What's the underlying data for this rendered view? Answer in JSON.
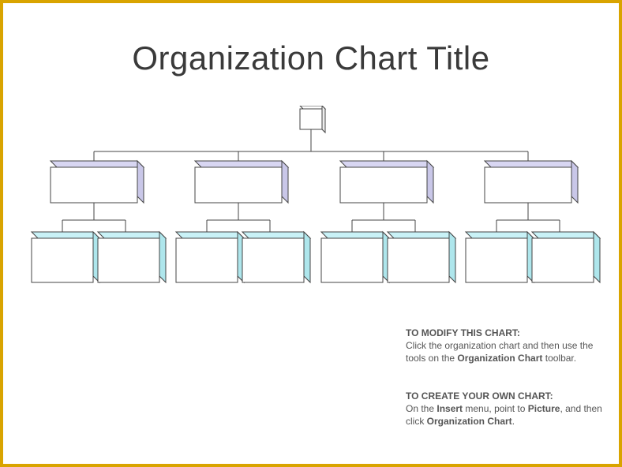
{
  "chart_data": {
    "type": "orgchart",
    "title": "Organization Chart Title",
    "root": {
      "label": ""
    },
    "tier1": [
      {
        "label": ""
      },
      {
        "label": ""
      },
      {
        "label": ""
      },
      {
        "label": ""
      }
    ],
    "tier2": [
      {
        "label": ""
      },
      {
        "label": ""
      },
      {
        "label": ""
      },
      {
        "label": ""
      },
      {
        "label": ""
      },
      {
        "label": ""
      },
      {
        "label": ""
      },
      {
        "label": ""
      }
    ],
    "colors": {
      "border": "#d9a400",
      "tier1_accent": "#d8d6f2",
      "tier2_accent": "#c9f2f7"
    }
  },
  "instructions": {
    "modify": {
      "heading": "TO MODIFY THIS CHART:",
      "line1_a": "Click the organization chart and then use the tools on the ",
      "line1_b_bold": "Organization Chart",
      "line1_c": " toolbar."
    },
    "create": {
      "heading": "TO CREATE YOUR OWN CHART:",
      "line_a": "On the ",
      "line_b_bold": "Insert",
      "line_c": " menu, point to ",
      "line_d_bold": "Picture",
      "line_e": ", and then click ",
      "line_f_bold": "Organization Chart",
      "line_g": "."
    }
  }
}
